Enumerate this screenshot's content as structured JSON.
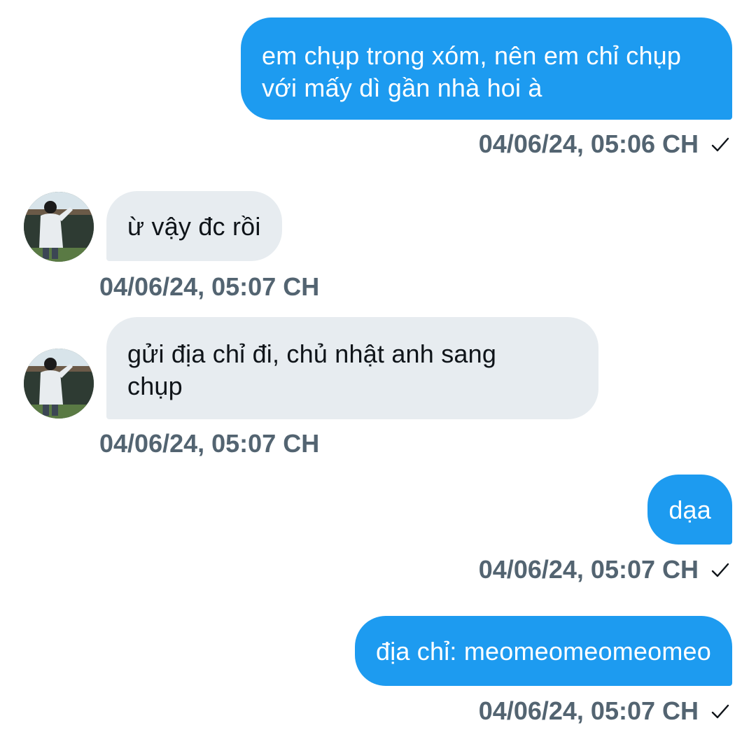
{
  "messages": [
    {
      "id": "m1",
      "direction": "sent",
      "text": "em chụp trong xóm, nên em chỉ chụp\nvới mấy dì gần nhà hoi à",
      "timestamp": "04/06/24, 05:06 CH",
      "seen": true
    },
    {
      "id": "m2",
      "direction": "received",
      "text": "ừ vậy đc rồi",
      "timestamp": "04/06/24, 05:07 CH",
      "seen": false
    },
    {
      "id": "m3",
      "direction": "received",
      "text": "gửi địa chỉ đi, chủ nhật anh sang\nchụp",
      "timestamp": "04/06/24, 05:07 CH",
      "seen": false
    },
    {
      "id": "m4",
      "direction": "sent",
      "text": "dạa",
      "timestamp": "04/06/24, 05:07 CH",
      "seen": true
    },
    {
      "id": "m5",
      "direction": "sent",
      "text": "địa chỉ: meomeomeomeomeo",
      "timestamp": "04/06/24, 05:07 CH",
      "seen": true
    }
  ],
  "colors": {
    "sent_bubble": "#1d9bf0",
    "received_bubble": "#e7ecf0",
    "timestamp": "#536471",
    "sent_text": "#ffffff",
    "received_text": "#0f1419"
  },
  "icons": {
    "read_receipt": "checkmark-icon",
    "contact_avatar": "avatar-photo"
  }
}
